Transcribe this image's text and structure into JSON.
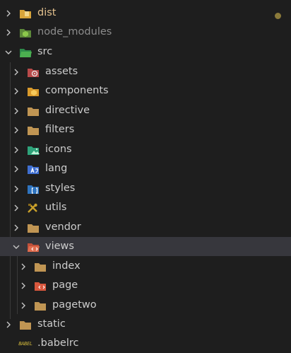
{
  "explorer": {
    "items": [
      {
        "label": "dist",
        "icon": "dist-folder-icon",
        "state": "modified"
      },
      {
        "label": "node_modules",
        "icon": "node-modules-folder-icon",
        "state": "ignored"
      },
      {
        "label": "src",
        "icon": "src-folder-open-icon"
      },
      {
        "label": "assets",
        "icon": "assets-folder-icon"
      },
      {
        "label": "components",
        "icon": "components-folder-icon"
      },
      {
        "label": "directive",
        "icon": "folder-icon"
      },
      {
        "label": "filters",
        "icon": "folder-icon"
      },
      {
        "label": "icons",
        "icon": "images-folder-icon"
      },
      {
        "label": "lang",
        "icon": "lang-folder-icon"
      },
      {
        "label": "styles",
        "icon": "styles-folder-icon"
      },
      {
        "label": "utils",
        "icon": "utils-folder-icon"
      },
      {
        "label": "vendor",
        "icon": "folder-icon"
      },
      {
        "label": "views",
        "icon": "views-folder-open-icon",
        "selected": true
      },
      {
        "label": "index",
        "icon": "folder-icon"
      },
      {
        "label": "page",
        "icon": "views-folder-icon"
      },
      {
        "label": "pagetwo",
        "icon": "folder-icon"
      },
      {
        "label": "static",
        "icon": "folder-icon"
      },
      {
        "label": ".babelrc",
        "icon": "babel-file-icon",
        "badge": "BABEL"
      }
    ]
  },
  "colors": {
    "background": "#1e1e1e",
    "selected_row": "#37373d",
    "modified_text": "#e2c08d",
    "ignored_text": "#8c8c8c",
    "folder": "#c09553"
  }
}
